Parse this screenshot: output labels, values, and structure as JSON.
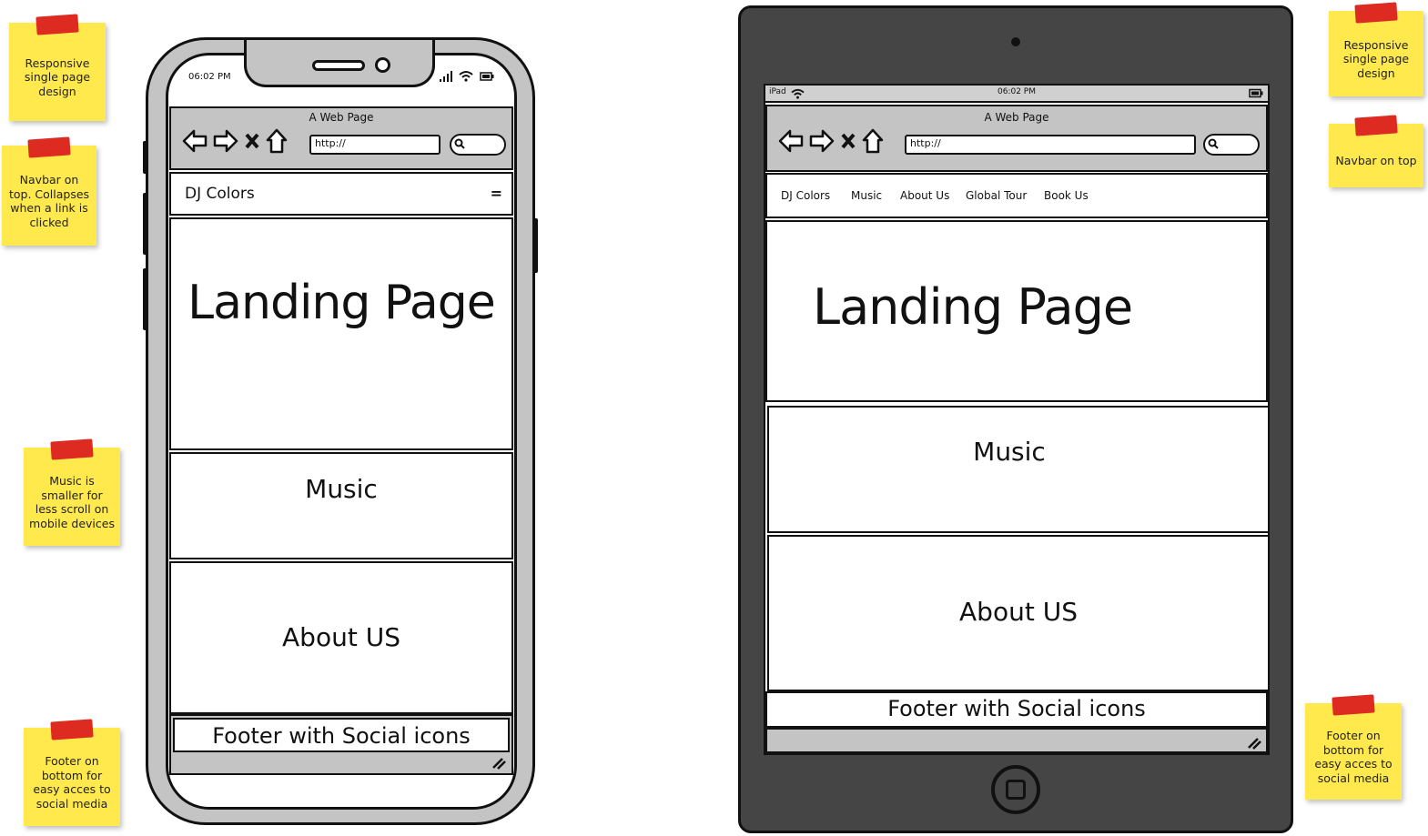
{
  "notes": {
    "phone_responsive": "Responsive single page design",
    "phone_navbar": "Navbar on top. Collapses when a link is clicked",
    "phone_music": "Music is smaller for less scroll on mobile devices",
    "phone_footer": "Footer on bottom for easy acces to social media",
    "tablet_responsive": "Responsive single page design",
    "tablet_navbar": "Navbar on top",
    "tablet_footer": "Footer on bottom for easy acces to social media"
  },
  "phone": {
    "time": "06:02 PM",
    "browser_title": "A Web Page",
    "url": "http://",
    "brand": "DJ Colors",
    "menu_icon": "=",
    "landing": "Landing Page",
    "music": "Music",
    "about": "About US",
    "footer": "Footer with Social icons"
  },
  "tablet": {
    "device_label": "iPad",
    "time": "06:02 PM",
    "browser_title": "A Web Page",
    "url": "http://",
    "nav": [
      "DJ Colors",
      "Music",
      "About Us",
      "Global Tour",
      "Book Us"
    ],
    "landing": "Landing Page",
    "music": "Music",
    "about": "About US",
    "footer": "Footer with Social icons"
  },
  "icons": [
    "back-arrow-icon",
    "forward-arrow-icon",
    "close-x-icon",
    "home-icon",
    "search-icon",
    "wifi-icon",
    "signal-icon",
    "battery-icon",
    "resize-grip-icon"
  ],
  "colors": {
    "note": "#ffe94d",
    "tape": "#dd2b22",
    "tablet_body": "#454545",
    "chrome_gray": "#c4c4c4"
  }
}
